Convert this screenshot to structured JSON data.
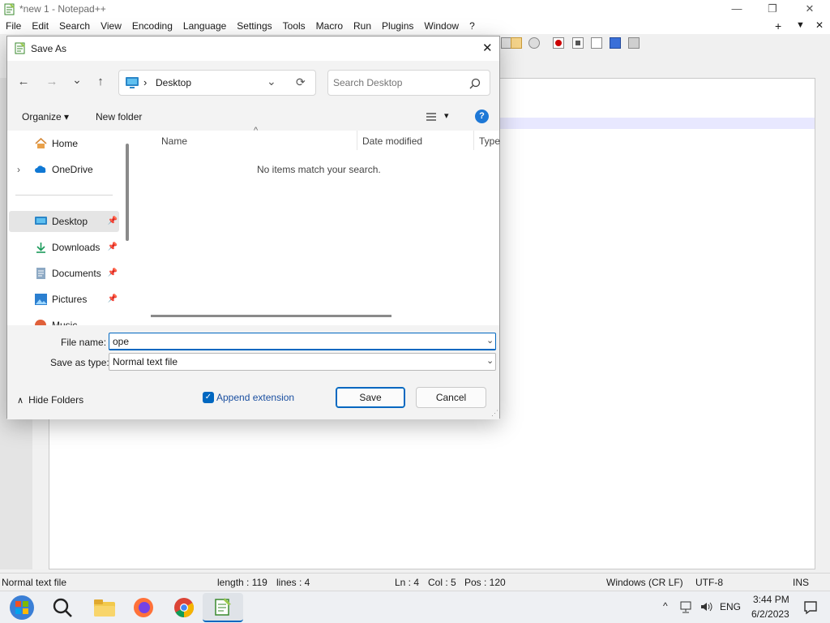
{
  "window": {
    "title": "*new 1 - Notepad++"
  },
  "menubar": [
    "File",
    "Edit",
    "Search",
    "View",
    "Encoding",
    "Language",
    "Settings",
    "Tools",
    "Macro",
    "Run",
    "Plugins",
    "Window",
    "?"
  ],
  "titlebar_right": {
    "plus": "+",
    "dropdown": "▼",
    "close": "✕"
  },
  "dialog": {
    "title": "Save As",
    "close": "✕",
    "nav": {
      "back": "←",
      "forward": "→",
      "recent": "⌄",
      "up": "↑"
    },
    "address": {
      "location": "Desktop",
      "sep": "›",
      "chevron": "⌄",
      "refresh": "⟳"
    },
    "search": {
      "placeholder": "Search Desktop"
    },
    "commands": {
      "organize": "Organize",
      "organize_caret": "▾",
      "new_folder": "New folder",
      "view_caret": "▾",
      "help": "?"
    },
    "navpane": {
      "items": [
        {
          "label": "Home",
          "icon": "home-icon",
          "expander": ""
        },
        {
          "label": "OneDrive",
          "icon": "cloud-icon",
          "expander": "›"
        },
        {
          "label": "Desktop",
          "icon": "desktop-icon",
          "pinned": true
        },
        {
          "label": "Downloads",
          "icon": "download-icon",
          "pinned": true
        },
        {
          "label": "Documents",
          "icon": "document-icon",
          "pinned": true
        },
        {
          "label": "Pictures",
          "icon": "picture-icon",
          "pinned": true
        },
        {
          "label": "Music",
          "icon": "music-icon",
          "pinned": true
        }
      ]
    },
    "columns": [
      "Name",
      "Date modified",
      "Type"
    ],
    "empty_message": "No items match your search.",
    "file_name": {
      "label": "File name:",
      "value": "ope"
    },
    "save_type": {
      "label": "Save as type:",
      "value": "Normal text file"
    },
    "hide_folders": "Hide Folders",
    "hide_caret": "∧",
    "append_extension": {
      "label": "Append extension",
      "checked": true
    },
    "save": "Save",
    "cancel": "Cancel"
  },
  "status": {
    "filetype": "Normal text file",
    "length": "length : 119",
    "lines": "lines : 4",
    "ln": "Ln : 4",
    "col": "Col : 5",
    "pos": "Pos : 120",
    "eol": "Windows (CR LF)",
    "encoding": "UTF-8",
    "mode": "INS"
  },
  "taskbar": {
    "lang": "ENG",
    "time": "3:44 PM",
    "date": "6/2/2023",
    "caret": "^"
  },
  "colors": {
    "accent": "#0067c0",
    "focus_border": "#0067c0",
    "current_line": "#e8e8ff"
  }
}
